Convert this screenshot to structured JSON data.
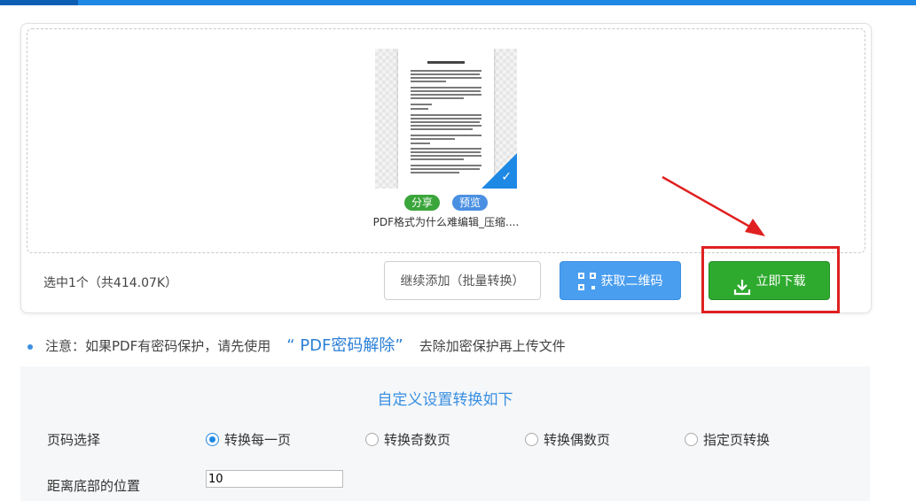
{
  "upload": {
    "file": {
      "name": "PDF格式为什么难编辑_压缩....",
      "share_label": "分享",
      "preview_label": "预览",
      "selected": true
    },
    "selected_info": "选中1个（共414.07K）",
    "buttons": {
      "continue_add": "继续添加（批量转换）",
      "get_qrcode": "获取二维码",
      "download_now": "立即下载"
    }
  },
  "note": {
    "prefix": "注意：如果PDF有密码保护，请先使用",
    "link": "“ PDF密码解除”",
    "suffix": "去除加密保护再上传文件"
  },
  "settings": {
    "title": "自定义设置转换如下",
    "page_select": {
      "label": "页码选择",
      "options": [
        {
          "label": "转换每一页",
          "checked": true
        },
        {
          "label": "转换奇数页",
          "checked": false
        },
        {
          "label": "转换偶数页",
          "checked": false
        },
        {
          "label": "指定页转换",
          "checked": false
        }
      ]
    },
    "bottom_distance": {
      "label": "距离底部的位置",
      "value": "10"
    }
  },
  "colors": {
    "accent": "#1e88e5",
    "download": "#2eaa2e",
    "qr_button": "#4a9ef0",
    "highlight": "#e02020"
  },
  "icons": [
    "checkmark-icon",
    "qrcode-icon",
    "download-icon",
    "red-arrow"
  ]
}
